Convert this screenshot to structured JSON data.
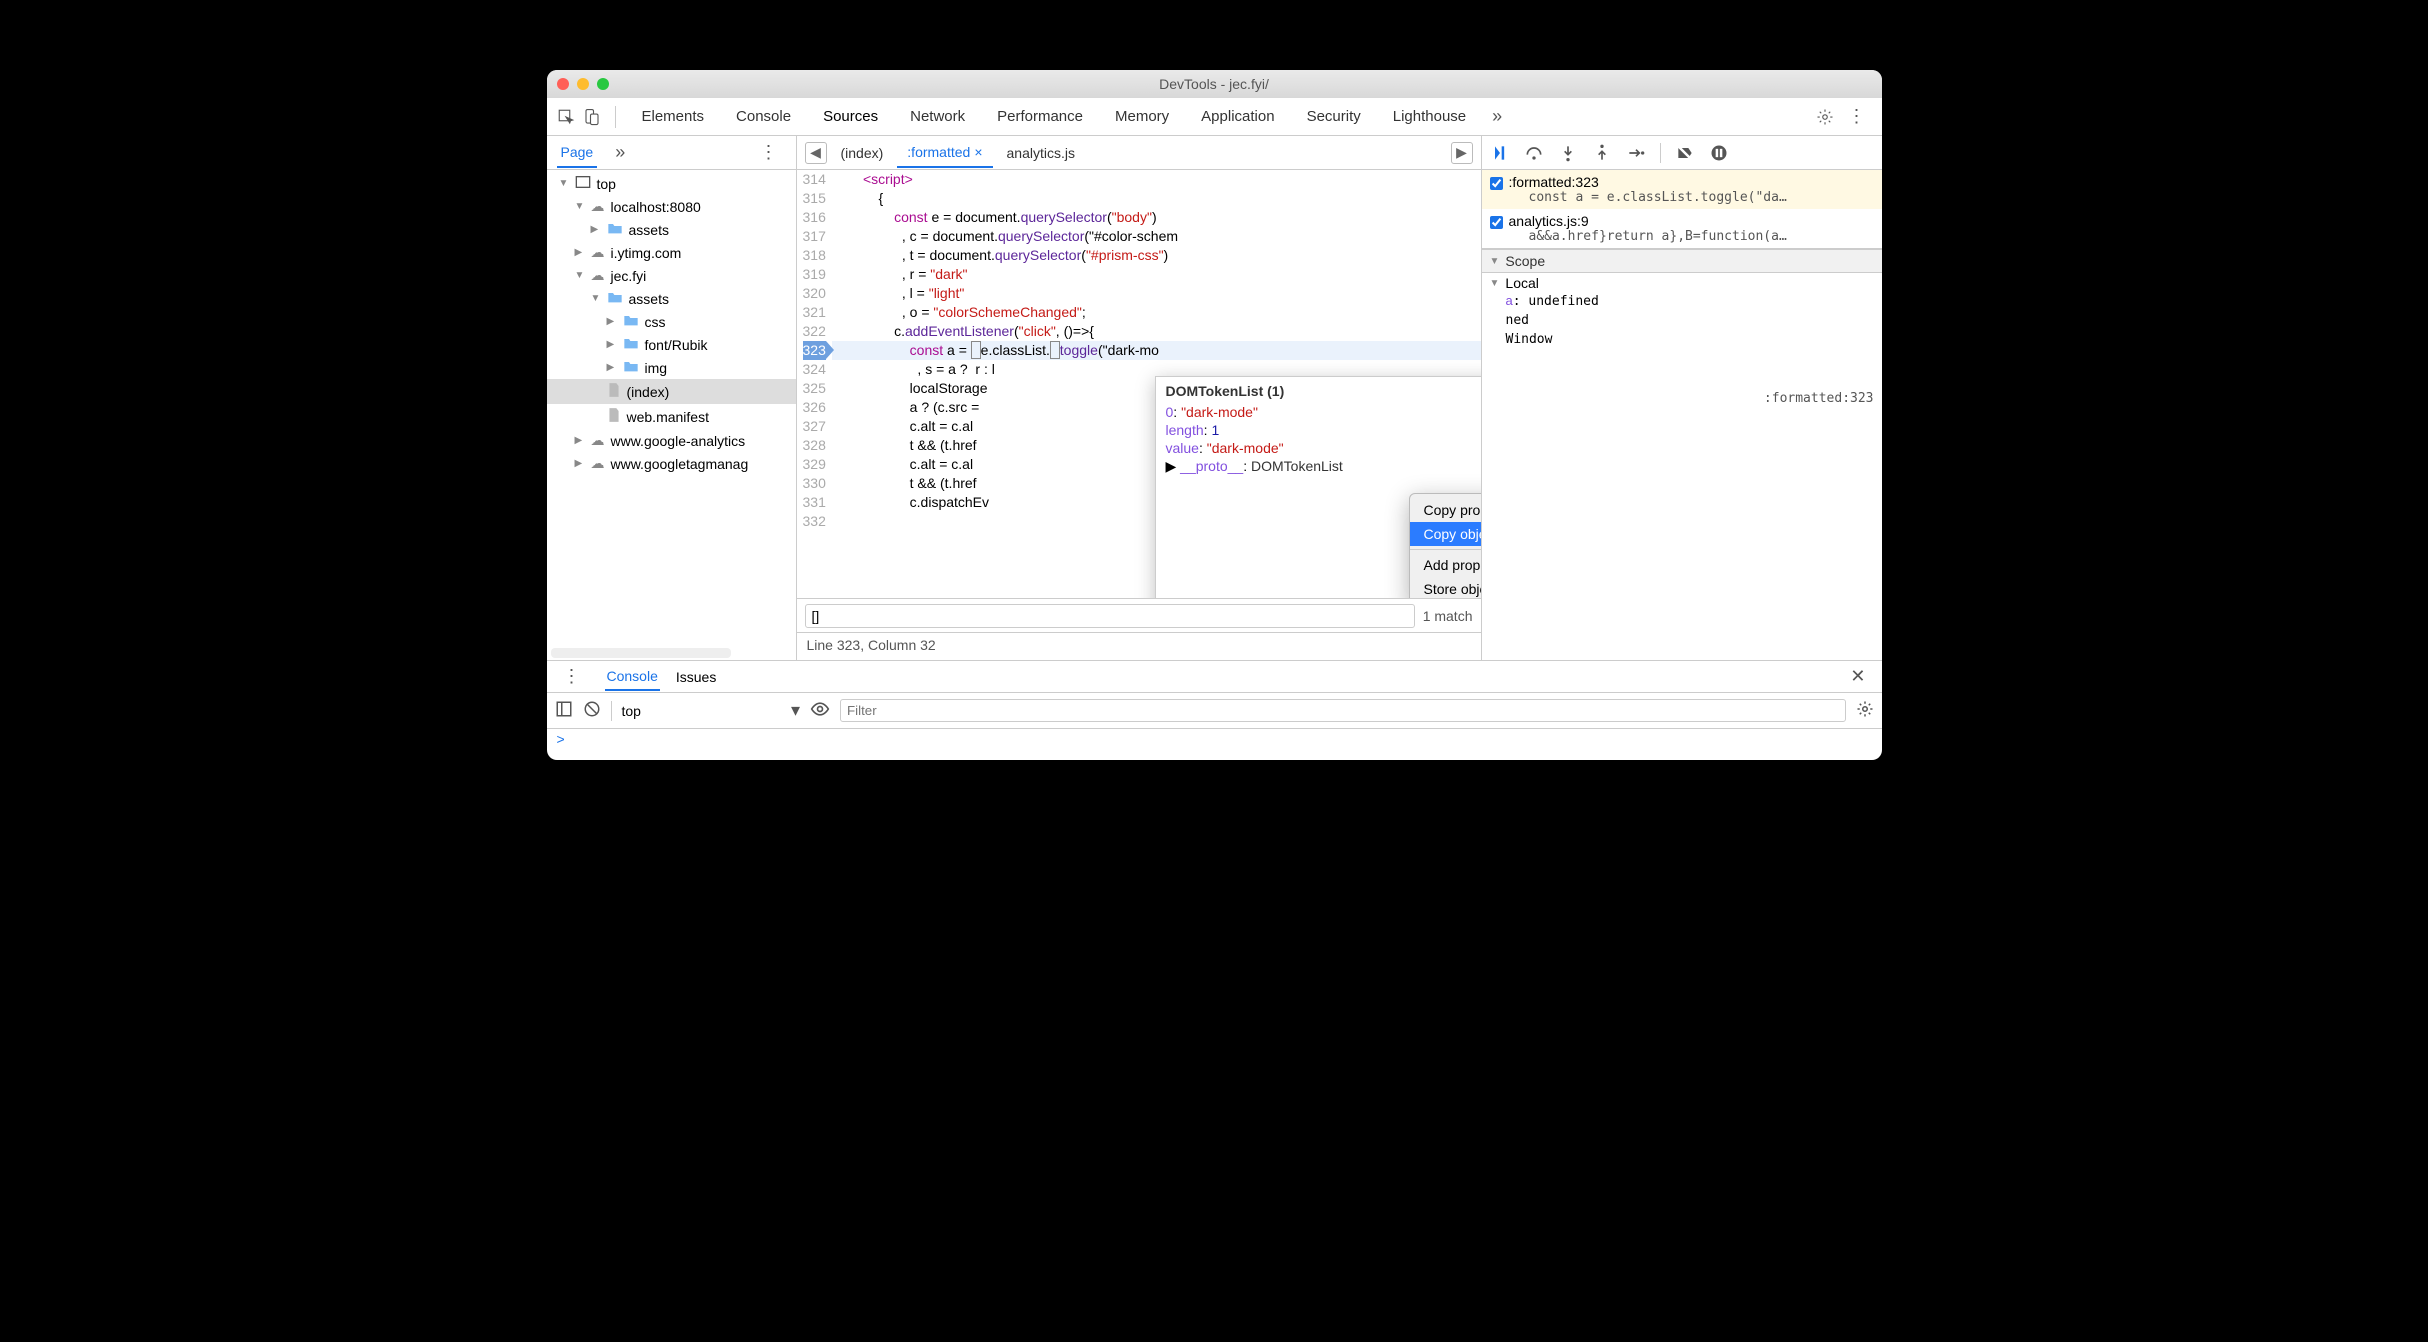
{
  "window": {
    "title": "DevTools - jec.fyi/"
  },
  "tabs": {
    "items": [
      "Elements",
      "Console",
      "Sources",
      "Network",
      "Performance",
      "Memory",
      "Application",
      "Security",
      "Lighthouse"
    ],
    "active": "Sources"
  },
  "page_nav": {
    "label": "Page"
  },
  "tree": {
    "root": "top",
    "nodes": [
      {
        "depth": 0,
        "twisty": "▼",
        "icon": "frame",
        "label": "top"
      },
      {
        "depth": 1,
        "twisty": "▼",
        "icon": "cloud",
        "label": "localhost:8080"
      },
      {
        "depth": 2,
        "twisty": "▶",
        "icon": "folder",
        "label": "assets"
      },
      {
        "depth": 1,
        "twisty": "▶",
        "icon": "cloud",
        "label": "i.ytimg.com"
      },
      {
        "depth": 1,
        "twisty": "▼",
        "icon": "cloud",
        "label": "jec.fyi"
      },
      {
        "depth": 2,
        "twisty": "▼",
        "icon": "folder",
        "label": "assets"
      },
      {
        "depth": 3,
        "twisty": "▶",
        "icon": "folder",
        "label": "css"
      },
      {
        "depth": 3,
        "twisty": "▶",
        "icon": "folder",
        "label": "font/Rubik"
      },
      {
        "depth": 3,
        "twisty": "▶",
        "icon": "folder",
        "label": "img"
      },
      {
        "depth": 2,
        "twisty": "",
        "icon": "file",
        "label": "(index)",
        "sel": true
      },
      {
        "depth": 2,
        "twisty": "",
        "icon": "file",
        "label": "web.manifest"
      },
      {
        "depth": 1,
        "twisty": "▶",
        "icon": "cloud",
        "label": "www.google-analytics"
      },
      {
        "depth": 1,
        "twisty": "▶",
        "icon": "cloud",
        "label": "www.googletagmanag"
      }
    ]
  },
  "file_tabs": {
    "items": [
      "(index)",
      ":formatted",
      "analytics.js"
    ],
    "active": ":formatted"
  },
  "code": {
    "first_line": 314,
    "highlight": 323,
    "lines": [
      "<script>",
      "    {",
      "        const e = document.querySelector(\"body\")",
      "          , c = document.querySelector(\"#color-schem",
      "          , t = document.querySelector(\"#prism-css\")",
      "          , r = \"dark\"",
      "          , l = \"light\"",
      "          , o = \"colorSchemeChanged\";",
      "        c.addEventListener(\"click\", ()=>{",
      "            const a = ▯e.classList.▯toggle(\"dark-mo",
      "              , s = a ?  r : l",
      "            localStorage",
      "            a ? (c.src =",
      "            c.alt = c.al",
      "            t && (t.href",
      "            c.alt = c.al",
      "            t && (t.href",
      "            c.dispatchEv",
      ""
    ]
  },
  "search": {
    "value": "[]",
    "status": "1 match"
  },
  "statusbar": "Line 323, Column 32",
  "breakpoints": [
    {
      "loc": ":formatted:323",
      "sub": "const a = e.classList.toggle(\"da…",
      "hl": true
    },
    {
      "loc": "analytics.js:9",
      "sub": "a&&a.href}return a},B=function(a…",
      "hl": false
    }
  ],
  "scope": {
    "header": "Scope",
    "local": "Local",
    "rows": [
      "a: undefined",
      "                     ned",
      "                   Window"
    ],
    "callstack_line": "                 :formatted:323"
  },
  "popup": {
    "header": "DOMTokenList (1)",
    "rows": [
      {
        "k": "0",
        "v": "\"dark-mode\"",
        "str": true
      },
      {
        "k": "length",
        "v": "1"
      },
      {
        "k": "value",
        "v": "\"dark-mode\"",
        "str": true
      },
      {
        "k": "__proto__",
        "v": "DOMTokenList",
        "link": true
      }
    ]
  },
  "ctx": {
    "items": [
      "Copy property path",
      "Copy object",
      "—",
      "Add property path to watch",
      "Store object as global variable"
    ],
    "selected": "Copy object"
  },
  "drawer": {
    "tabs": [
      "Console",
      "Issues"
    ],
    "active": "Console",
    "context": "top",
    "filter_placeholder": "Filter",
    "prompt": ">"
  }
}
